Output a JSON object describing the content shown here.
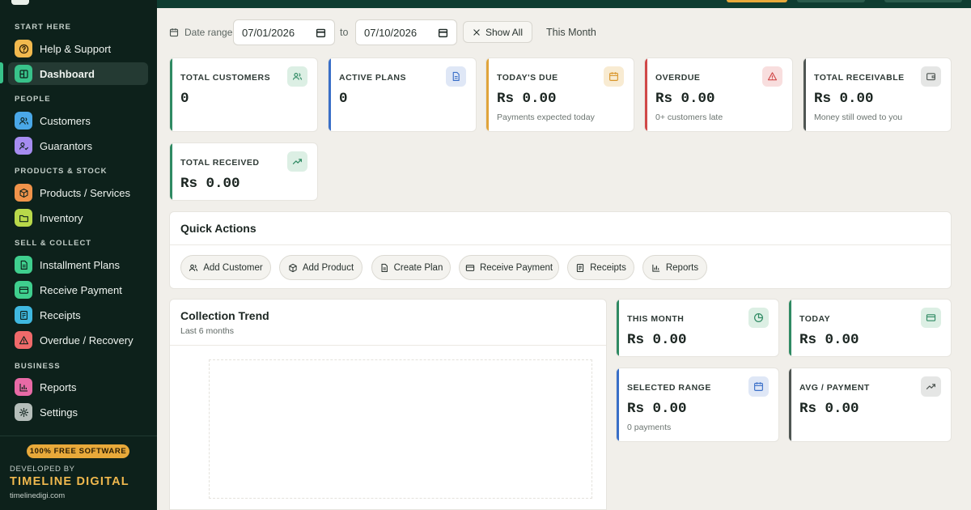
{
  "sidebar": {
    "sections": [
      "START HERE",
      "PEOPLE",
      "PRODUCTS & STOCK",
      "SELL & COLLECT",
      "BUSINESS"
    ],
    "items": [
      {
        "label": "Help & Support",
        "icon": "help-icon",
        "color": "#f1b94e"
      },
      {
        "label": "Dashboard",
        "icon": "dashboard-icon",
        "color": "#38c28a"
      },
      {
        "label": "Customers",
        "icon": "users-icon",
        "color": "#4aa8e8"
      },
      {
        "label": "Guarantors",
        "icon": "user-check-icon",
        "color": "#a68cf0"
      },
      {
        "label": "Products / Services",
        "icon": "box-icon",
        "color": "#f0934a"
      },
      {
        "label": "Inventory",
        "icon": "folder-icon",
        "color": "#b8d84a"
      },
      {
        "label": "Installment Plans",
        "icon": "document-icon",
        "color": "#3fcf8e"
      },
      {
        "label": "Receive Payment",
        "icon": "card-icon",
        "color": "#3fcf8e"
      },
      {
        "label": "Receipts",
        "icon": "receipt-icon",
        "color": "#3fb8e0"
      },
      {
        "label": "Overdue / Recovery",
        "icon": "alert-icon",
        "color": "#ef6a6a"
      },
      {
        "label": "Reports",
        "icon": "bar-chart-icon",
        "color": "#e86aa6"
      },
      {
        "label": "Settings",
        "icon": "gear-icon",
        "color": "#b5beba"
      }
    ],
    "footer": {
      "badge": "100% FREE SOFTWARE",
      "developed_by": "DEVELOPED BY",
      "company": "TIMELINE DIGITAL",
      "url": "timelinedigi.com"
    }
  },
  "filter": {
    "date_range_label": "Date range",
    "from_date": "07/01/2026",
    "to_label": "to",
    "to_date": "07/10/2026",
    "show_all": "Show All",
    "this_month": "This Month"
  },
  "stats": [
    {
      "title": "TOTAL CUSTOMERS",
      "value": "0",
      "sub": "",
      "icon": "users-icon",
      "accent": "#2f8a63"
    },
    {
      "title": "ACTIVE PLANS",
      "value": "0",
      "sub": "",
      "icon": "document-icon",
      "accent": "#3a6fc8"
    },
    {
      "title": "TODAY'S DUE",
      "value": "Rs 0.00",
      "sub": "Payments expected today",
      "icon": "calendar-icon",
      "accent": "#e0a43a"
    },
    {
      "title": "OVERDUE",
      "value": "Rs 0.00",
      "sub": "0+ customers late",
      "icon": "alert-icon",
      "accent": "#d04848"
    },
    {
      "title": "TOTAL RECEIVABLE",
      "value": "Rs 0.00",
      "sub": "Money still owed to you",
      "icon": "wallet-icon",
      "accent": "#4f5653"
    },
    {
      "title": "TOTAL RECEIVED",
      "value": "Rs 0.00",
      "sub": "",
      "icon": "trend-up-icon",
      "accent": "#2f8a63"
    }
  ],
  "quick_actions": {
    "title": "Quick Actions",
    "buttons": [
      "Add Customer",
      "Add Product",
      "Create Plan",
      "Receive Payment",
      "Receipts",
      "Reports"
    ]
  },
  "trend": {
    "title": "Collection Trend",
    "subtitle": "Last 6 months"
  },
  "mini_stats": [
    {
      "title": "THIS MONTH",
      "value": "Rs 0.00",
      "sub": "",
      "icon": "clock-icon",
      "accent": "#2f8a63"
    },
    {
      "title": "TODAY",
      "value": "Rs 0.00",
      "sub": "",
      "icon": "card-icon",
      "accent": "#2f8a63"
    },
    {
      "title": "SELECTED RANGE",
      "value": "Rs 0.00",
      "sub": "0 payments",
      "icon": "calendar-icon",
      "accent": "#3a6fc8"
    },
    {
      "title": "AVG / PAYMENT",
      "value": "Rs 0.00",
      "sub": "",
      "icon": "trend-up-icon",
      "accent": "#4f5653"
    }
  ]
}
